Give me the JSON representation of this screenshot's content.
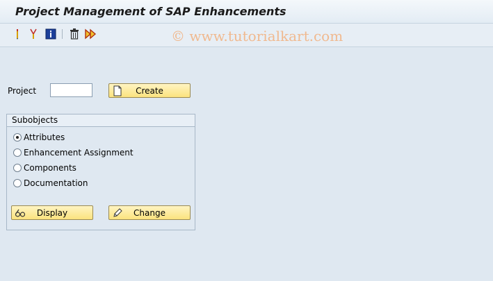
{
  "window": {
    "title": "Project Management of SAP Enhancements"
  },
  "watermark": "© www.tutorialkart.com",
  "toolbar": {
    "icons": [
      "pencil-icon",
      "scissors-icon",
      "info-icon",
      "trash-icon",
      "forward-icon"
    ]
  },
  "project": {
    "label": "Project",
    "value": "",
    "create_label": "Create"
  },
  "subobjects": {
    "title": "Subobjects",
    "options": [
      {
        "label": "Attributes",
        "selected": true
      },
      {
        "label": "Enhancement Assignment",
        "selected": false
      },
      {
        "label": "Components",
        "selected": false
      },
      {
        "label": "Documentation",
        "selected": false
      }
    ],
    "display_label": "Display",
    "change_label": "Change"
  },
  "colors": {
    "background": "#dfe8f1",
    "button": "#fbe37e",
    "watermark": "#f0b98f"
  }
}
